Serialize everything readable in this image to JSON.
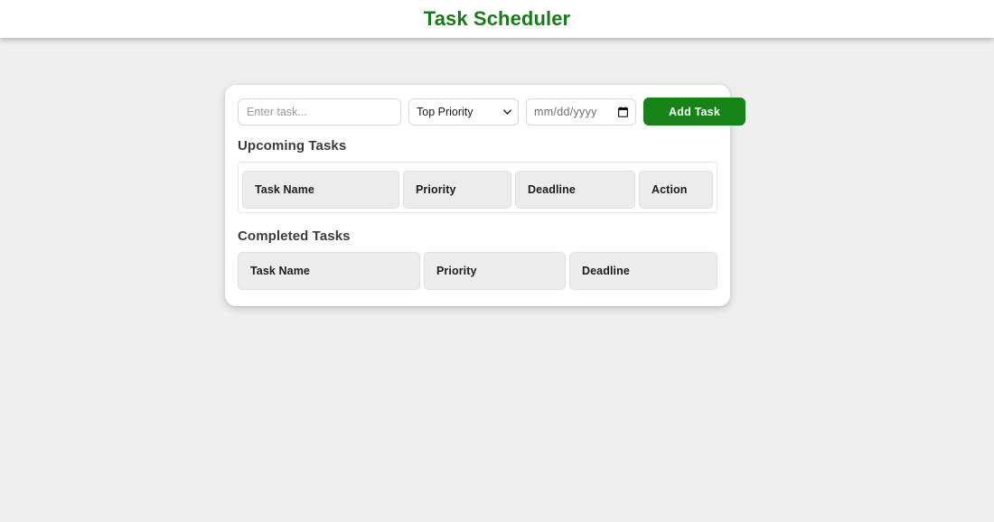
{
  "header": {
    "title": "Task Scheduler",
    "title_color": "#1a7a1a"
  },
  "form": {
    "task_input": {
      "value": "",
      "placeholder": "Enter task..."
    },
    "priority_select": {
      "selected": "Top Priority",
      "chevron_icon": "chevron-down-icon"
    },
    "date_input": {
      "value": "",
      "placeholder": "mm/dd/yyyy",
      "icon": "calendar-icon"
    },
    "add_button": {
      "label": "Add Task",
      "color": "#178217"
    }
  },
  "upcoming": {
    "heading": "Upcoming Tasks",
    "columns": [
      "Task Name",
      "Priority",
      "Deadline",
      "Action"
    ],
    "rows": []
  },
  "completed": {
    "heading": "Completed Tasks",
    "columns": [
      "Task Name",
      "Priority",
      "Deadline"
    ],
    "rows": []
  },
  "theme": {
    "page_background": "#efefef",
    "card_background": "#ffffff",
    "header_cell_background": "#ececec"
  }
}
